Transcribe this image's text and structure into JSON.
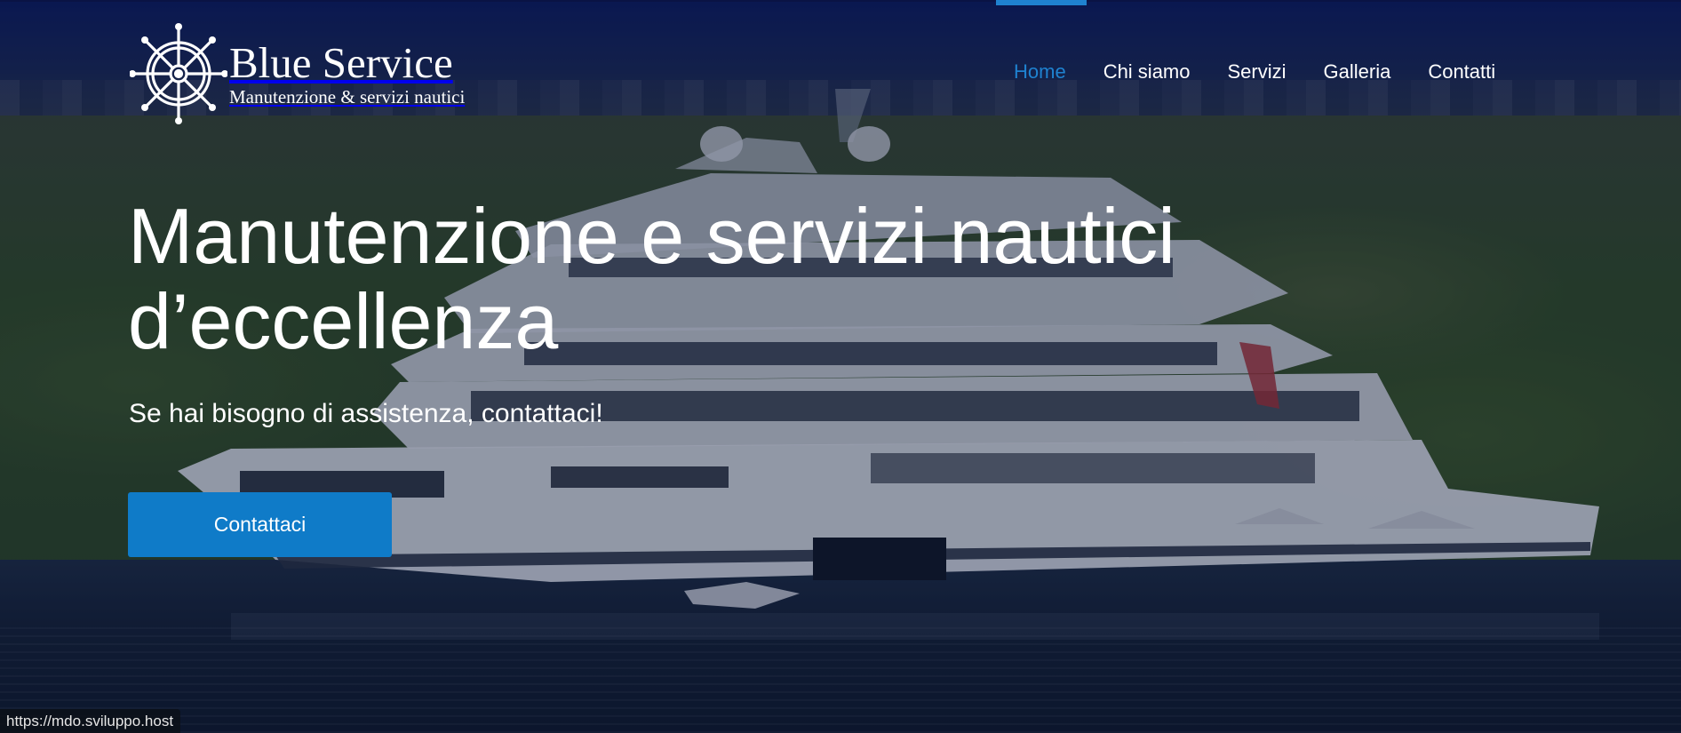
{
  "brand": {
    "name": "Blue Service",
    "tagline": "Manutenzione & servizi nautici",
    "logo_icon": "ship-wheel-icon"
  },
  "nav": {
    "items": [
      {
        "label": "Home",
        "active": true
      },
      {
        "label": "Chi siamo",
        "active": false
      },
      {
        "label": "Servizi",
        "active": false
      },
      {
        "label": "Galleria",
        "active": false
      },
      {
        "label": "Contatti",
        "active": false
      }
    ]
  },
  "hero": {
    "title_line1": "Manutenzione e servizi nautici",
    "title_line2": "d’eccellenza",
    "subtitle": "Se hai bisogno di assistenza, contattaci!",
    "cta_label": "Contattaci"
  },
  "status_bar": {
    "url": "https://mdo.sviluppo.host"
  },
  "colors": {
    "accent": "#1f82d0",
    "button": "#0f7bc8",
    "text": "#ffffff"
  }
}
